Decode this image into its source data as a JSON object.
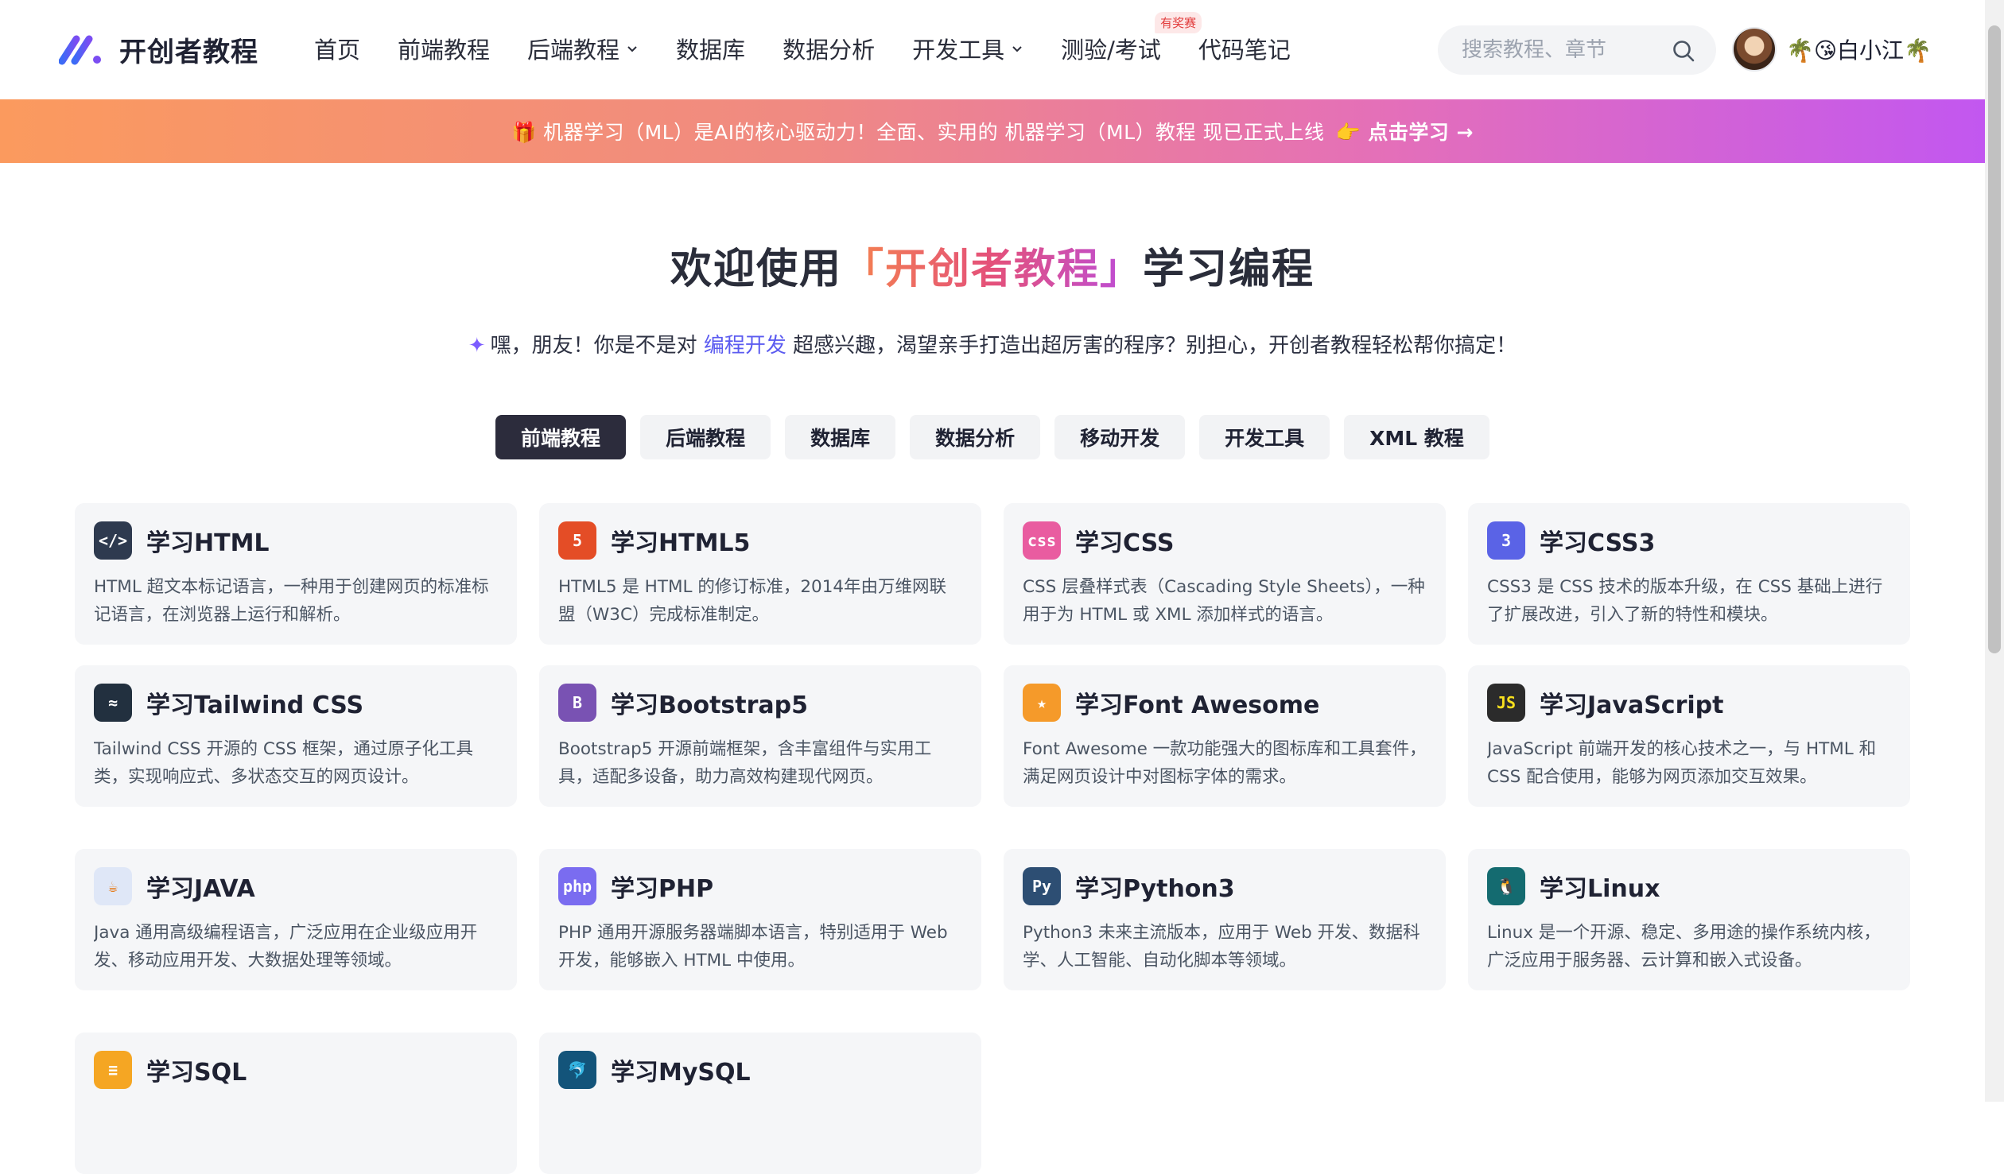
{
  "header": {
    "logo_text": "开创者教程",
    "nav": [
      {
        "label": "首页",
        "dropdown": false
      },
      {
        "label": "前端教程",
        "dropdown": false
      },
      {
        "label": "后端教程",
        "dropdown": true
      },
      {
        "label": "数据库",
        "dropdown": false
      },
      {
        "label": "数据分析",
        "dropdown": false
      },
      {
        "label": "开发工具",
        "dropdown": true
      },
      {
        "label": "测验/考试",
        "dropdown": false,
        "badge": "有奖赛"
      },
      {
        "label": "代码笔记",
        "dropdown": false
      }
    ],
    "search_placeholder": "搜索教程、章节",
    "username": "🌴😘白小江🌴"
  },
  "banner": {
    "text": "🎁 机器学习（ML）是AI的核心驱动力！全面、实用的 机器学习（ML）教程 现已正式上线",
    "cta": "👉 点击学习 →"
  },
  "hero": {
    "title_pre": "欢迎使用",
    "title_brand": "「开创者教程」",
    "title_post": "学习编程",
    "sub_pre": "✦",
    "sub_a": "嘿，朋友！你是不是对",
    "sub_hl": "编程开发",
    "sub_b": "超感兴趣，渴望亲手打造出超厉害的程序？别担心，开创者教程轻松帮你搞定！"
  },
  "tabs": [
    {
      "label": "前端教程",
      "active": true
    },
    {
      "label": "后端教程",
      "active": false
    },
    {
      "label": "数据库",
      "active": false
    },
    {
      "label": "数据分析",
      "active": false
    },
    {
      "label": "移动开发",
      "active": false
    },
    {
      "label": "开发工具",
      "active": false
    },
    {
      "label": "XML 教程",
      "active": false
    }
  ],
  "cards": [
    {
      "title": "学习HTML",
      "icon": "html-icon",
      "icon_bg": "#2e3a4f",
      "icon_text": "</>",
      "desc": "HTML 超文本标记语言，一种用于创建网页的标准标记语言，在浏览器上运行和解析。"
    },
    {
      "title": "学习HTML5",
      "icon": "html5-icon",
      "icon_bg": "#e44d26",
      "icon_text": "5",
      "desc": "HTML5 是 HTML 的修订标准，2014年由万维网联盟（W3C）完成标准制定。"
    },
    {
      "title": "学习CSS",
      "icon": "css-icon",
      "icon_bg": "#e95ca0",
      "icon_text": "css",
      "desc": "CSS 层叠样式表（Cascading Style Sheets），一种用于为 HTML 或 XML 添加样式的语言。"
    },
    {
      "title": "学习CSS3",
      "icon": "css3-icon",
      "icon_bg": "#5a63e6",
      "icon_text": "3",
      "desc": "CSS3 是 CSS 技术的版本升级，在 CSS 基础上进行了扩展改进，引入了新的特性和模块。"
    },
    {
      "title": "学习Tailwind CSS",
      "icon": "tailwind-icon",
      "icon_bg": "#22303f",
      "icon_text": "≈",
      "desc": "Tailwind CSS 开源的 CSS 框架，通过原子化工具类，实现响应式、多状态交互的网页设计。"
    },
    {
      "title": "学习Bootstrap5",
      "icon": "bootstrap-icon",
      "icon_bg": "#7952b3",
      "icon_text": "B",
      "desc": "Bootstrap5 开源前端框架，含丰富组件与实用工具，适配多设备，助力高效构建现代网页。"
    },
    {
      "title": "学习Font Awesome",
      "icon": "font-awesome-icon",
      "icon_bg": "#f59a2a",
      "icon_text": "★",
      "desc": "Font Awesome 一款功能强大的图标库和工具套件，满足网页设计中对图标字体的需求。"
    },
    {
      "title": "学习JavaScript",
      "icon": "javascript-icon",
      "icon_bg": "#2b2b2b",
      "icon_text": "JS",
      "desc": "JavaScript 前端开发的核心技术之一，与 HTML 和 CSS 配合使用，能够为网页添加交互效果。"
    },
    {
      "title": "学习JAVA",
      "icon": "java-icon",
      "icon_bg": "#dfe7f7",
      "icon_text": "☕",
      "desc": "Java 通用高级编程语言，广泛应用在企业级应用开发、移动应用开发、大数据处理等领域。"
    },
    {
      "title": "学习PHP",
      "icon": "php-icon",
      "icon_bg": "#7a6cf0",
      "icon_text": "php",
      "desc": "PHP 通用开源服务器端脚本语言，特别适用于 Web 开发，能够嵌入 HTML 中使用。"
    },
    {
      "title": "学习Python3",
      "icon": "python-icon",
      "icon_bg": "#2d4e73",
      "icon_text": "Py",
      "desc": "Python3 未来主流版本，应用于 Web 开发、数据科学、人工智能、自动化脚本等领域。"
    },
    {
      "title": "学习Linux",
      "icon": "linux-icon",
      "icon_bg": "#146b70",
      "icon_text": "🐧",
      "desc": "Linux 是一个开源、稳定、多用途的操作系统内核，广泛应用于服务器、云计算和嵌入式设备。"
    },
    {
      "title": "学习SQL",
      "icon": "sql-icon",
      "icon_bg": "#f5a623",
      "icon_text": "≡",
      "desc": ""
    },
    {
      "title": "学习MySQL",
      "icon": "mysql-icon",
      "icon_bg": "#13547a",
      "icon_text": "🐬",
      "desc": ""
    }
  ]
}
